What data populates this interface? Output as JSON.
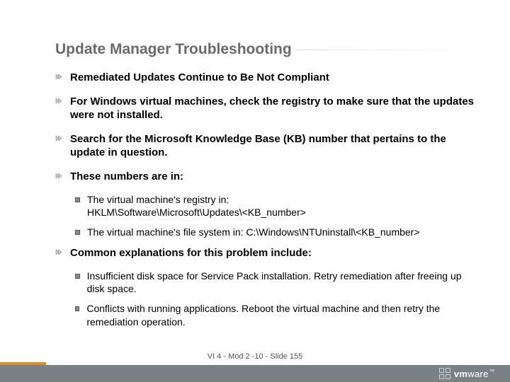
{
  "title": "Update Manager Troubleshooting",
  "bullets": {
    "b1": "Remediated Updates Continue to Be Not Compliant",
    "b2": "For Windows virtual machines, check the registry to make sure that the updates were not installed.",
    "b3": "Search for the Microsoft Knowledge Base (KB) number that pertains to the update in question.",
    "b4": "These numbers are in:",
    "b4a_l1": "The virtual machine's registry in:",
    "b4a_l2": "HKLM\\Software\\Microsoft\\Updates\\<KB_number>",
    "b4b": "The virtual machine's file system in: C:\\Windows\\NTUninstall\\<KB_number>",
    "b5": "Common explanations for this problem include:",
    "b5a": "Insufficient disk space for Service Pack installation. Retry remediation after freeing up disk space.",
    "b5b": "Conflicts with running applications. Reboot the virtual machine and then retry the remediation operation."
  },
  "footer": {
    "label": "VI 4 - Mod 2 -10 - Slide",
    "page": "155"
  },
  "brand": {
    "vm": "vm",
    "ware": "ware",
    "tm": "™"
  }
}
